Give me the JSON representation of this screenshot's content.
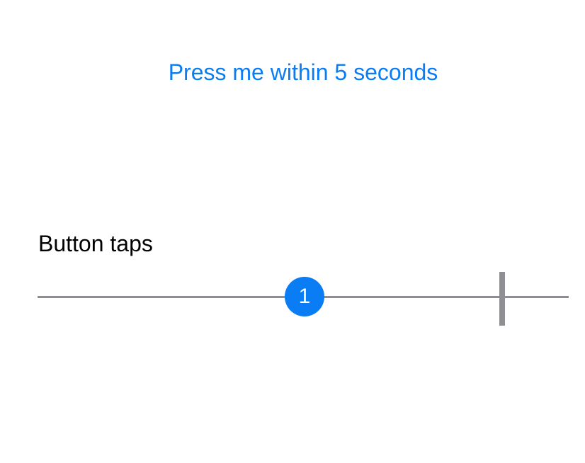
{
  "button": {
    "label": "Press me within 5 seconds"
  },
  "timeline": {
    "label": "Button taps",
    "marker_value": "1"
  },
  "colors": {
    "accent": "#0a7cf4",
    "track": "#8e8e93",
    "background": "#ffffff"
  }
}
